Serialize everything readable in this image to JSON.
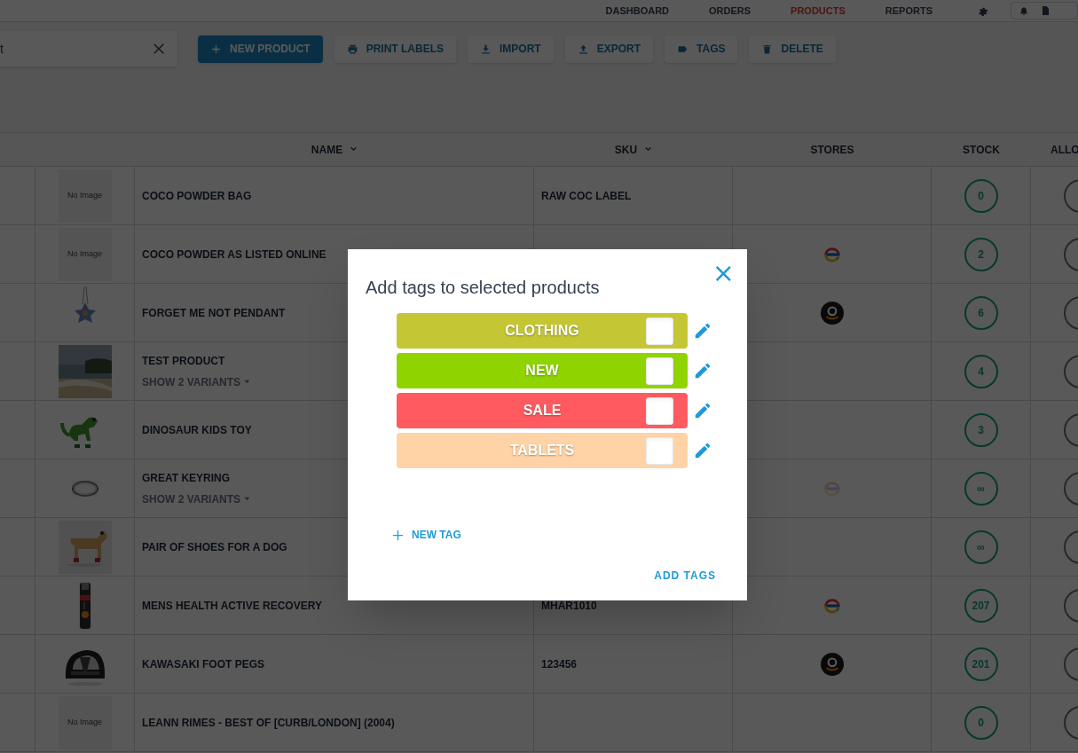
{
  "nav": [
    {
      "label": "DASHBOARD",
      "selected": false
    },
    {
      "label": "ORDERS",
      "selected": false
    },
    {
      "label": "PRODUCTS",
      "selected": true
    },
    {
      "label": "REPORTS",
      "selected": false
    }
  ],
  "search": {
    "value": "t"
  },
  "toolbar": [
    {
      "kind": "primary",
      "label": "NEW PRODUCT"
    },
    {
      "kind": "plain",
      "label": "PRINT LABELS"
    },
    {
      "kind": "plain",
      "label": "IMPORT"
    },
    {
      "kind": "plain",
      "label": "EXPORT"
    },
    {
      "kind": "plain",
      "label": "TAGS"
    },
    {
      "kind": "plain",
      "label": "DELETE"
    }
  ],
  "table": {
    "columns": [
      {
        "label": "NAME",
        "sortable": true
      },
      {
        "label": "SKU",
        "sortable": true
      },
      {
        "label": "STORES",
        "sortable": false
      },
      {
        "label": "STOCK",
        "sortable": false
      },
      {
        "label": "ALLO"
      }
    ],
    "rows": [
      {
        "image": {
          "kind": "placeholder",
          "text": "No Image"
        },
        "name": "COCO POWDER BAG",
        "sku": "RAW COC LABEL",
        "stock": "0"
      },
      {
        "image": {
          "kind": "placeholder",
          "text": "No Image"
        },
        "name": "COCO POWDER AS LISTED ONLINE",
        "store": {
          "kind": "ebay",
          "muted": false
        },
        "stock": "2"
      },
      {
        "name": "FORGET ME NOT PENDANT",
        "store": {
          "kind": "amazon",
          "muted": false
        },
        "stock": "6"
      },
      {
        "name": "TEST PRODUCT",
        "variants": "SHOW 2 VARIANTS",
        "stock": "4"
      },
      {
        "name": "DINOSAUR KIDS TOY",
        "stock": "3"
      },
      {
        "name": "GREAT KEYRING",
        "variants": "SHOW 2 VARIANTS",
        "store": {
          "kind": "ebay",
          "muted": true
        },
        "stock": "∞"
      },
      {
        "name": "PAIR OF SHOES FOR A DOG",
        "stock": "∞"
      },
      {
        "name": "MENS HEALTH ACTIVE RECOVERY",
        "sku": "MHAR1010",
        "store": {
          "kind": "ebay",
          "muted": false
        },
        "stock": "207"
      },
      {
        "name": "KAWASAKI FOOT PEGS",
        "sku": "123456",
        "store": {
          "kind": "amazon",
          "muted": false
        },
        "stock": "201"
      },
      {
        "image": {
          "kind": "placeholder",
          "text": "No Image"
        },
        "name": "LEANN RIMES - BEST OF [CURB/LONDON] (2004)",
        "stock": "0"
      }
    ]
  },
  "dialog": {
    "title": "Add tags to selected products",
    "close": "×",
    "tags": [
      {
        "label": "CLOTHING",
        "color": "#c5c634",
        "checked": false
      },
      {
        "label": "NEW",
        "color": "#8fd300",
        "checked": false
      },
      {
        "label": "SALE",
        "color": "#ff5a5f",
        "checked": false
      },
      {
        "label": "TABLETS",
        "color": "#ffd3a5",
        "checked": false
      }
    ],
    "new_tag": "NEW TAG",
    "submit": "ADD TAGS"
  }
}
